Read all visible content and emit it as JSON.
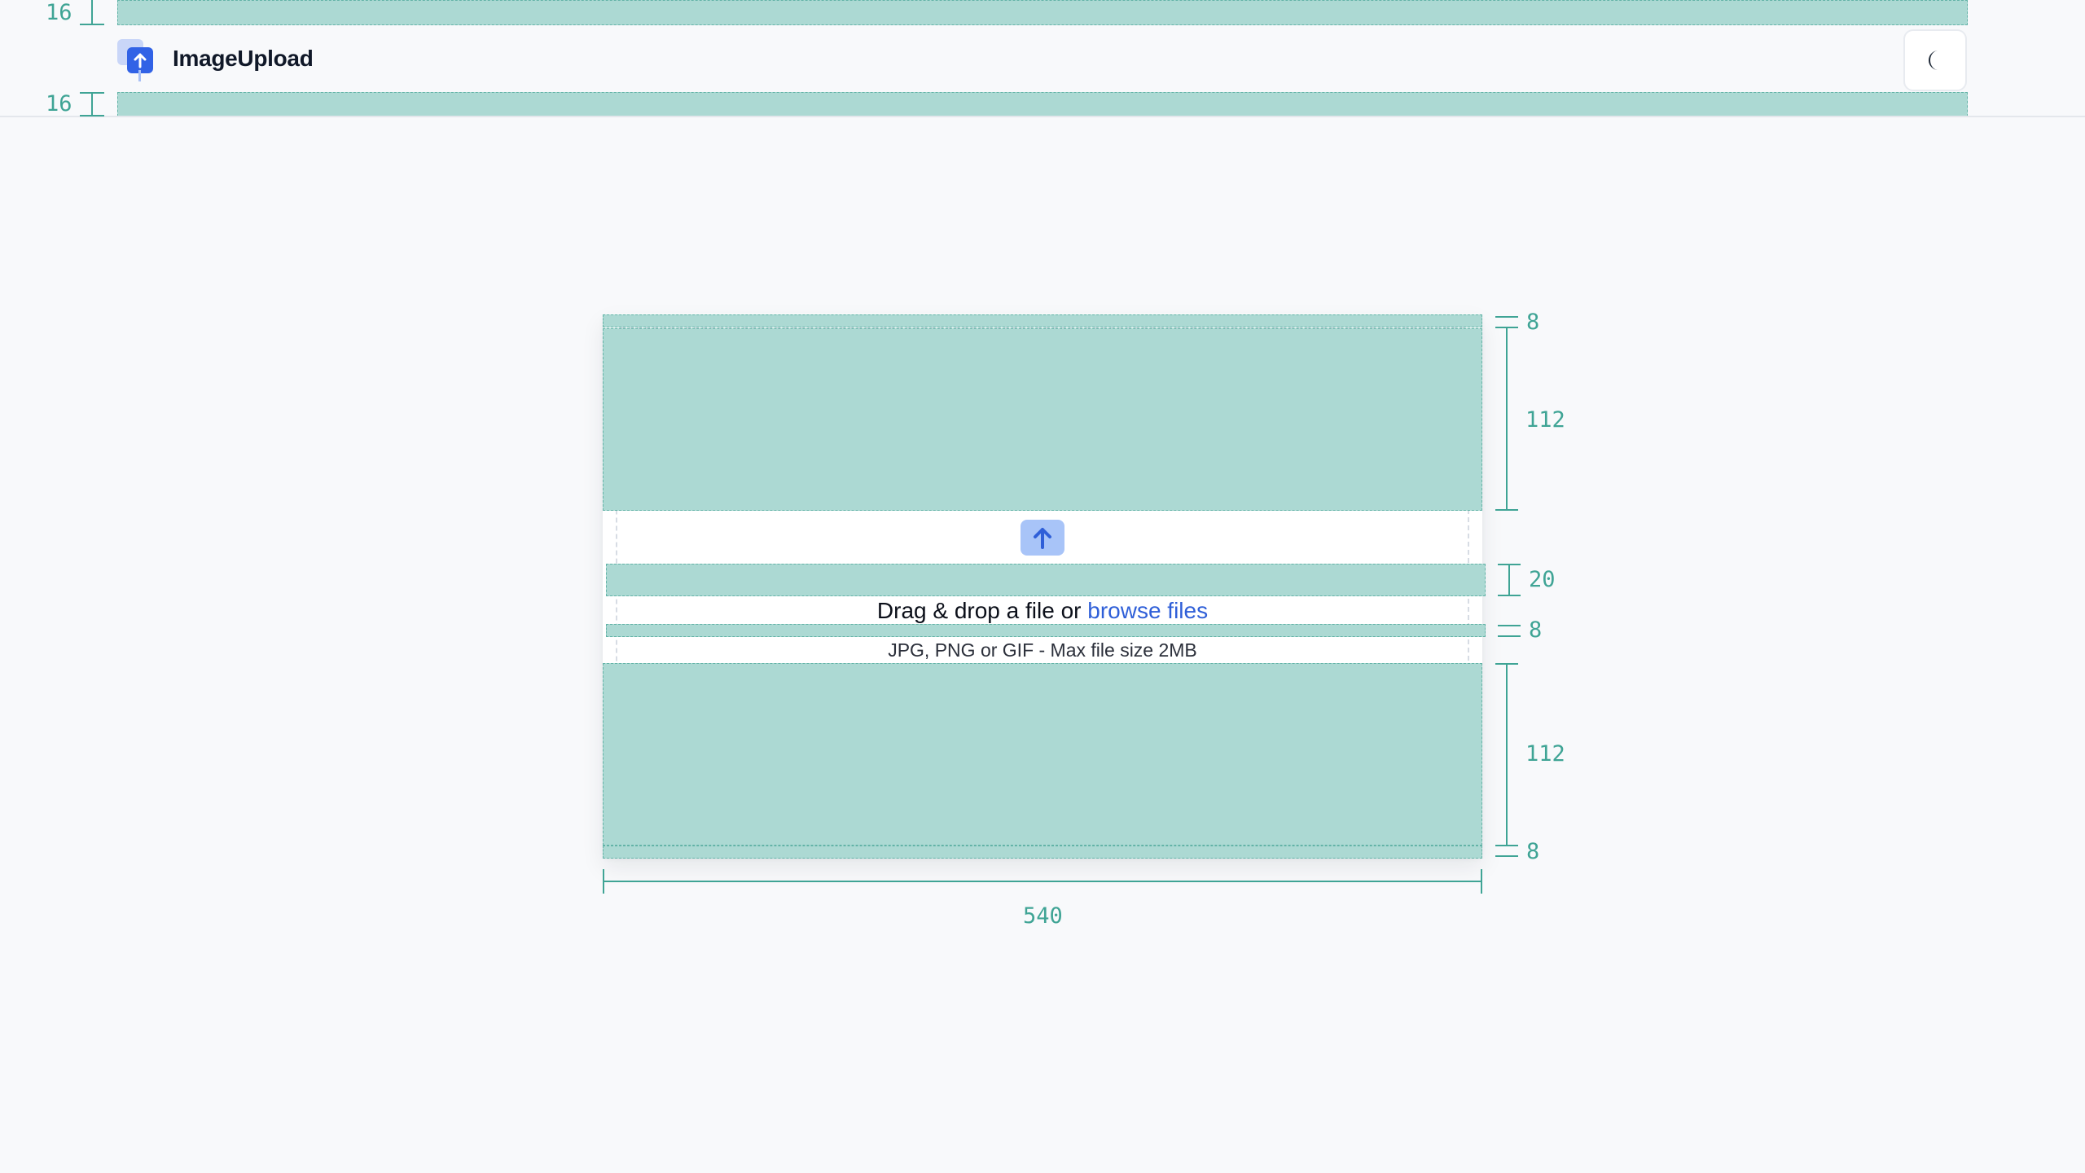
{
  "header": {
    "app_name": "ImageUpload",
    "logo_icon": "upload-logo-icon",
    "theme_toggle_icon": "moon-icon"
  },
  "upload": {
    "icon": "arrow-up-icon",
    "prompt_text": "Drag & drop a file or ",
    "browse_label": "browse files",
    "hint": "JPG, PNG or GIF - Max file size 2MB"
  },
  "annotations": {
    "header_top": "16",
    "header_bottom": "16",
    "card_pad_top": "8",
    "space_top": "112",
    "icon_gap": "20",
    "text_gap": "8",
    "space_bottom": "112",
    "card_pad_bottom": "8",
    "card_width": "540"
  },
  "colors": {
    "accent": "#3162e6",
    "link": "#2f5fd8",
    "overlay": "#acd9d3",
    "overlay_text": "#3fa495"
  }
}
